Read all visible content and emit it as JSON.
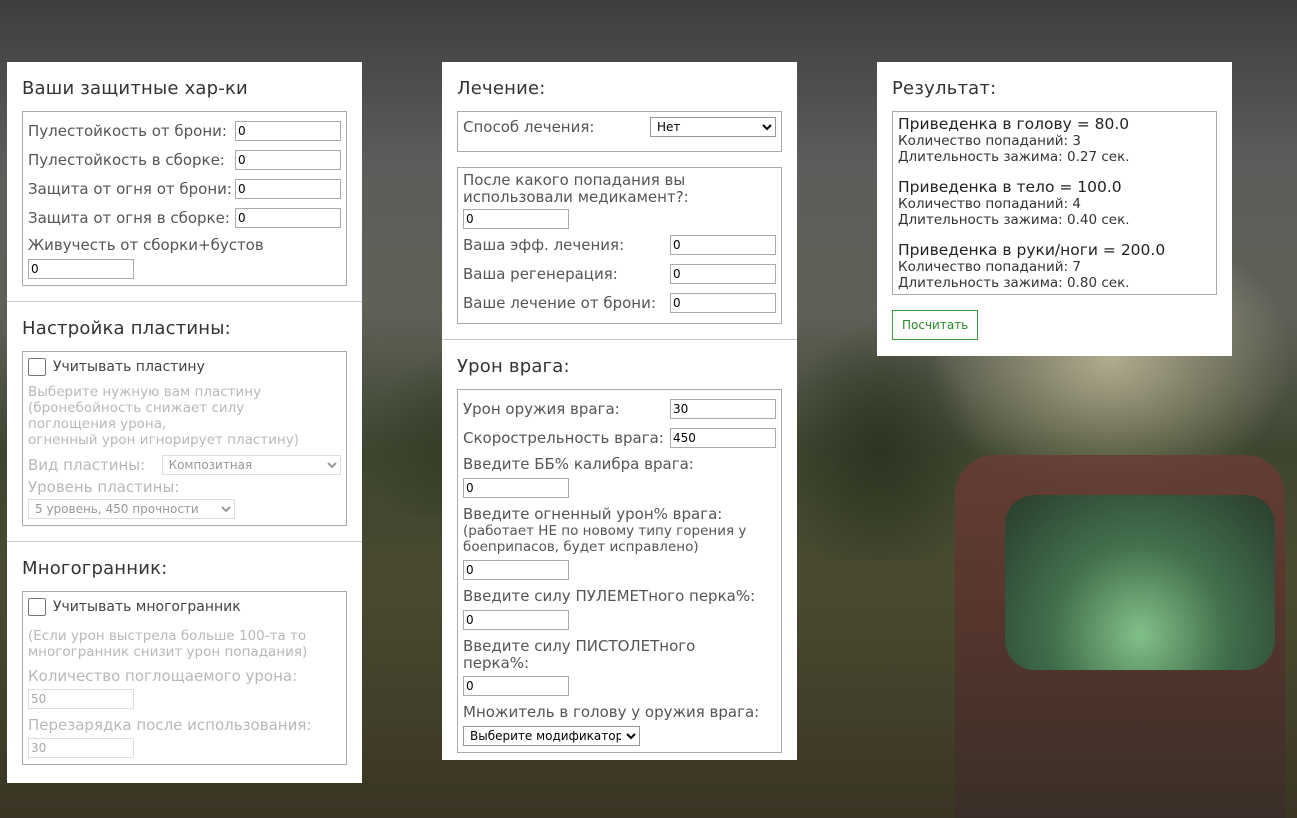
{
  "col1": {
    "defense": {
      "title": "Ваши защитные хар-ки",
      "bullet_armor_label": "Пулестойкость от брони:",
      "bullet_armor_value": "0",
      "bullet_build_label": "Пулестойкость в сборке:",
      "bullet_build_value": "0",
      "fire_armor_label": "Защита от огня от брони:",
      "fire_armor_value": "0",
      "fire_build_label": "Защита от огня в сборке:",
      "fire_build_value": "0",
      "vitality_label": "Живучесть от сборки+бустов",
      "vitality_value": "0"
    },
    "plate": {
      "title": "Настройка пластины:",
      "checkbox_label": "Учитывать пластину",
      "note_lines": [
        "Выберите нужную вам пластину",
        "(бронебойность снижает силу",
        "поглощения урона,",
        "огненный урон игнорирует пластину)"
      ],
      "kind_label": "Вид пластины:",
      "kind_value": "Композитная",
      "level_label": "Уровень пластины:",
      "level_value": "5 уровень, 450 прочности"
    },
    "poly": {
      "title": "Многогранник:",
      "checkbox_label": "Учитывать многогранник",
      "note_lines": [
        "(Если урон выстрела больше 100-та то",
        "многогранник снизит урон попадания)"
      ],
      "absorb_label": "Количество поглощаемого урона:",
      "absorb_value": "50",
      "reload_label": "Перезарядка после использования:",
      "reload_value": "30"
    }
  },
  "col2": {
    "heal": {
      "title": "Лечение:",
      "method_label": "Способ лечения:",
      "method_value": "Нет",
      "after_hit_lines": [
        "После какого попадания вы",
        "использовали медикамент?:"
      ],
      "after_hit_value": "0",
      "eff_label": "Ваша эфф. лечения:",
      "eff_value": "0",
      "regen_label": "Ваша регенерация:",
      "regen_value": "0",
      "armor_heal_label": "Ваше лечение от брони:",
      "armor_heal_value": "0"
    },
    "enemy": {
      "title": "Урон врага:",
      "weapon_dmg_label": "Урон оружия врага:",
      "weapon_dmg_value": "30",
      "rate_label": "Скорострельность врага:",
      "rate_value": "450",
      "ap_label": "Введите ББ% калибра врага:",
      "ap_value": "0",
      "fire_label": "Введите огненный урон% врага:",
      "fire_note_lines": [
        "(работает НЕ по новому типу горения у",
        "боеприпасов, будет исправлено)"
      ],
      "fire_value": "0",
      "mg_label": "Введите силу ПУЛЕМЕТного перка%:",
      "mg_value": "0",
      "pistol_lines": [
        "Введите силу ПИСТОЛЕТного",
        "перка%:"
      ],
      "pistol_value": "0",
      "head_mult_label": "Множитель в голову у оружия врага:",
      "head_mult_value": "Выберите модификатор:"
    }
  },
  "col3": {
    "title": "Результат:",
    "results": [
      {
        "title": "Приведенка в голову = 80.0",
        "hits": "Количество попаданий: 3",
        "duration": "Длительность зажима: 0.27 сек."
      },
      {
        "title": "Приведенка в тело = 100.0",
        "hits": "Количество попаданий: 4",
        "duration": "Длительность зажима: 0.40 сек."
      },
      {
        "title": "Приведенка в руки/ноги = 200.0",
        "hits": "Количество попаданий: 7",
        "duration": "Длительность зажима: 0.80 сек."
      }
    ],
    "button_label": "Посчитать"
  }
}
